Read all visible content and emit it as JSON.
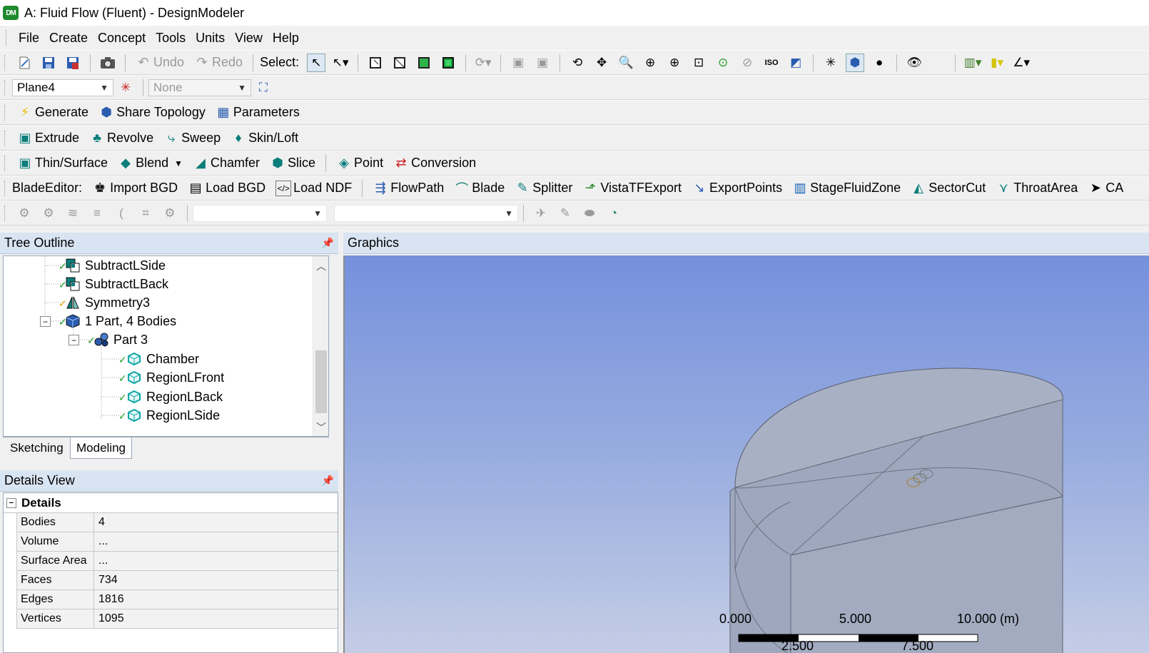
{
  "window": {
    "title": "A: Fluid Flow (Fluent) - DesignModeler",
    "icon_text": "DM"
  },
  "menu": [
    "File",
    "Create",
    "Concept",
    "Tools",
    "Units",
    "View",
    "Help"
  ],
  "toolbar1": {
    "undo": "Undo",
    "redo": "Redo",
    "select": "Select:"
  },
  "toolbar2": {
    "plane": "Plane4",
    "sketch": "None"
  },
  "toolbar3": {
    "generate": "Generate",
    "share_topology": "Share Topology",
    "parameters": "Parameters"
  },
  "toolbar4": {
    "extrude": "Extrude",
    "revolve": "Revolve",
    "sweep": "Sweep",
    "skin_loft": "Skin/Loft"
  },
  "toolbar5": {
    "thin_surface": "Thin/Surface",
    "blend": "Blend",
    "chamfer": "Chamfer",
    "slice": "Slice",
    "point": "Point",
    "conversion": "Conversion"
  },
  "toolbar6": {
    "label": "BladeEditor:",
    "items": [
      "Import BGD",
      "Load BGD",
      "Load NDF",
      "FlowPath",
      "Blade",
      "Splitter",
      "VistaTFExport",
      "ExportPoints",
      "StageFluidZone",
      "SectorCut",
      "ThroatArea",
      "CA"
    ]
  },
  "tree_outline": {
    "title": "Tree Outline",
    "items": [
      {
        "label": "SubtractLSide",
        "icon": "boolean-icon"
      },
      {
        "label": "SubtractLBack",
        "icon": "boolean-icon"
      },
      {
        "label": "Symmetry3",
        "icon": "symmetry-icon"
      },
      {
        "label": "1 Part, 4 Bodies",
        "icon": "parts-icon"
      },
      {
        "label": "Part 3",
        "icon": "part-icon"
      },
      {
        "label": "Chamber",
        "icon": "body-icon"
      },
      {
        "label": "RegionLFront",
        "icon": "body-icon"
      },
      {
        "label": "RegionLBack",
        "icon": "body-icon"
      },
      {
        "label": "RegionLSide",
        "icon": "body-icon"
      }
    ]
  },
  "tabs": {
    "sketching": "Sketching",
    "modeling": "Modeling"
  },
  "details_view": {
    "title": "Details View",
    "group": "Details",
    "rows": [
      {
        "key": "Bodies",
        "value": "4"
      },
      {
        "key": "Volume",
        "value": "..."
      },
      {
        "key": "Surface Area",
        "value": "..."
      },
      {
        "key": "Faces",
        "value": "734"
      },
      {
        "key": "Edges",
        "value": "1816"
      },
      {
        "key": "Vertices",
        "value": "1095"
      }
    ]
  },
  "graphics": {
    "title": "Graphics",
    "scale_top": [
      "0.000",
      "5.000",
      "10.000 (m)"
    ],
    "scale_bottom": [
      "2.500",
      "7.500"
    ]
  }
}
